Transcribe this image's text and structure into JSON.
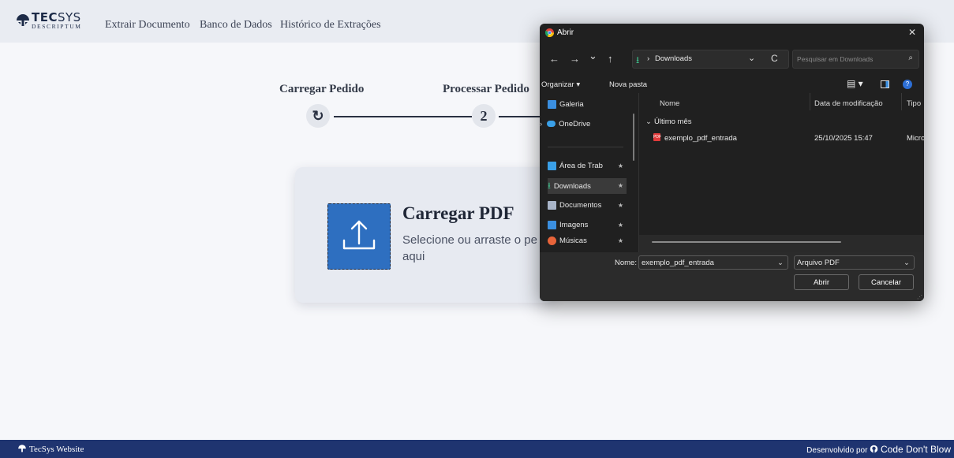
{
  "header": {
    "logo_main": "TEC",
    "logo_alt": "SYS",
    "logo_sub": "DESCRIPTUM",
    "nav": [
      "Extrair Documento",
      "Banco de Dados",
      "Histórico de Extrações"
    ]
  },
  "steps": [
    {
      "label": "Carregar Pedido",
      "marker": "↻"
    },
    {
      "label": "Processar Pedido",
      "marker": "2"
    }
  ],
  "upload_card": {
    "title": "Carregar PDF",
    "description": "Selecione ou arraste o pe\naqui"
  },
  "footer": {
    "left": "TecSys Website",
    "right_prefix": "Desenvolvido por",
    "right_brand": "Code Don't Blow"
  },
  "dialog": {
    "title": "Abrir",
    "close": "✕",
    "nav": {
      "back": "←",
      "forward": "→",
      "recent": "⌄",
      "up": "↑",
      "refresh": "C"
    },
    "path": "Downloads",
    "search_placeholder": "Pesquisar em Downloads",
    "organize": "Organizar ▾",
    "new_folder": "Nova pasta",
    "sidebar": [
      {
        "label": "Galeria",
        "icon": "gallery-icon",
        "color": "#3b8fe0"
      },
      {
        "label": "OneDrive",
        "icon": "cloud-icon",
        "color": "#3aa0e8"
      },
      {
        "label": "Área de Trab",
        "icon": "desktop-icon",
        "color": "#3aa0e8"
      },
      {
        "label": "Downloads",
        "icon": "download-icon",
        "color": "#3ec18c"
      },
      {
        "label": "Documentos",
        "icon": "document-icon",
        "color": "#a8b4c8"
      },
      {
        "label": "Imagens",
        "icon": "image-icon",
        "color": "#3b8fe0"
      },
      {
        "label": "Músicas",
        "icon": "music-icon",
        "color": "#e8643a"
      }
    ],
    "columns": [
      "Nome",
      "Data de modificação",
      "Tipo"
    ],
    "group": "Último mês",
    "file": {
      "name": "exemplo_pdf_entrada",
      "date": "25/10/2025 15:47",
      "type": "Micro"
    },
    "name_label": "Nome:",
    "name_value": "exemplo_pdf_entrada",
    "filetype": "Arquivo PDF",
    "open": "Abrir",
    "cancel": "Cancelar"
  },
  "colors": {
    "accent": "#2e6fc0",
    "footer": "#1f3470",
    "dialog_bg": "#202020"
  }
}
